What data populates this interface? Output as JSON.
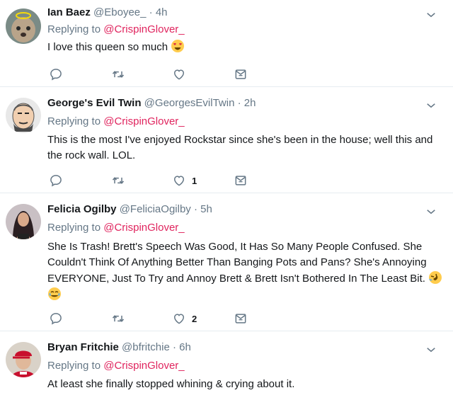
{
  "tweets": [
    {
      "name": "Ian Baez",
      "handle": "@Eboyee_",
      "time": "4h",
      "reply_prefix": "Replying to",
      "reply_user": "@CrispinGlover_",
      "text": "I love this queen so much",
      "emojis": [
        "heart-eyes-emoji"
      ],
      "like_count": ""
    },
    {
      "name": "George's Evil Twin",
      "handle": "@GeorgesEvilTwin",
      "time": "2h",
      "reply_prefix": "Replying to",
      "reply_user": "@CrispinGlover_",
      "text": "This is the most I've enjoyed Rockstar since she's been in the house; well this and the rock wall. LOL.",
      "like_count": "1"
    },
    {
      "name": "Felicia Ogilby",
      "handle": "@FeliciaOgilby",
      "time": "5h",
      "reply_prefix": "Replying to",
      "reply_user": "@CrispinGlover_",
      "text": "She Is Trash! Brett's Speech Was Good, It Has So Many People Confused. She Couldn't Think Of Anything Better Than Banging Pots and Pans? She's Annoying EVERYONE, Just To Try and Annoy Brett & Brett Isn't Bothered In The Least Bit.",
      "emojis": [
        "rofl-emoji",
        "tears-of-joy-emoji"
      ],
      "like_count": "2"
    },
    {
      "name": "Bryan Fritchie",
      "handle": "@bfritchie",
      "time": "6h",
      "reply_prefix": "Replying to",
      "reply_user": "@CrispinGlover_",
      "text": "At least she finally stopped whining & crying about it.",
      "like_count": ""
    }
  ],
  "separator": "·",
  "colors": {
    "reply_link": "#e0245e",
    "muted": "#657786",
    "text": "#14171a",
    "border": "#e6ecf0"
  },
  "icons": [
    "reply-icon",
    "retweet-icon",
    "like-icon",
    "direct-message-icon",
    "chevron-down-icon"
  ]
}
